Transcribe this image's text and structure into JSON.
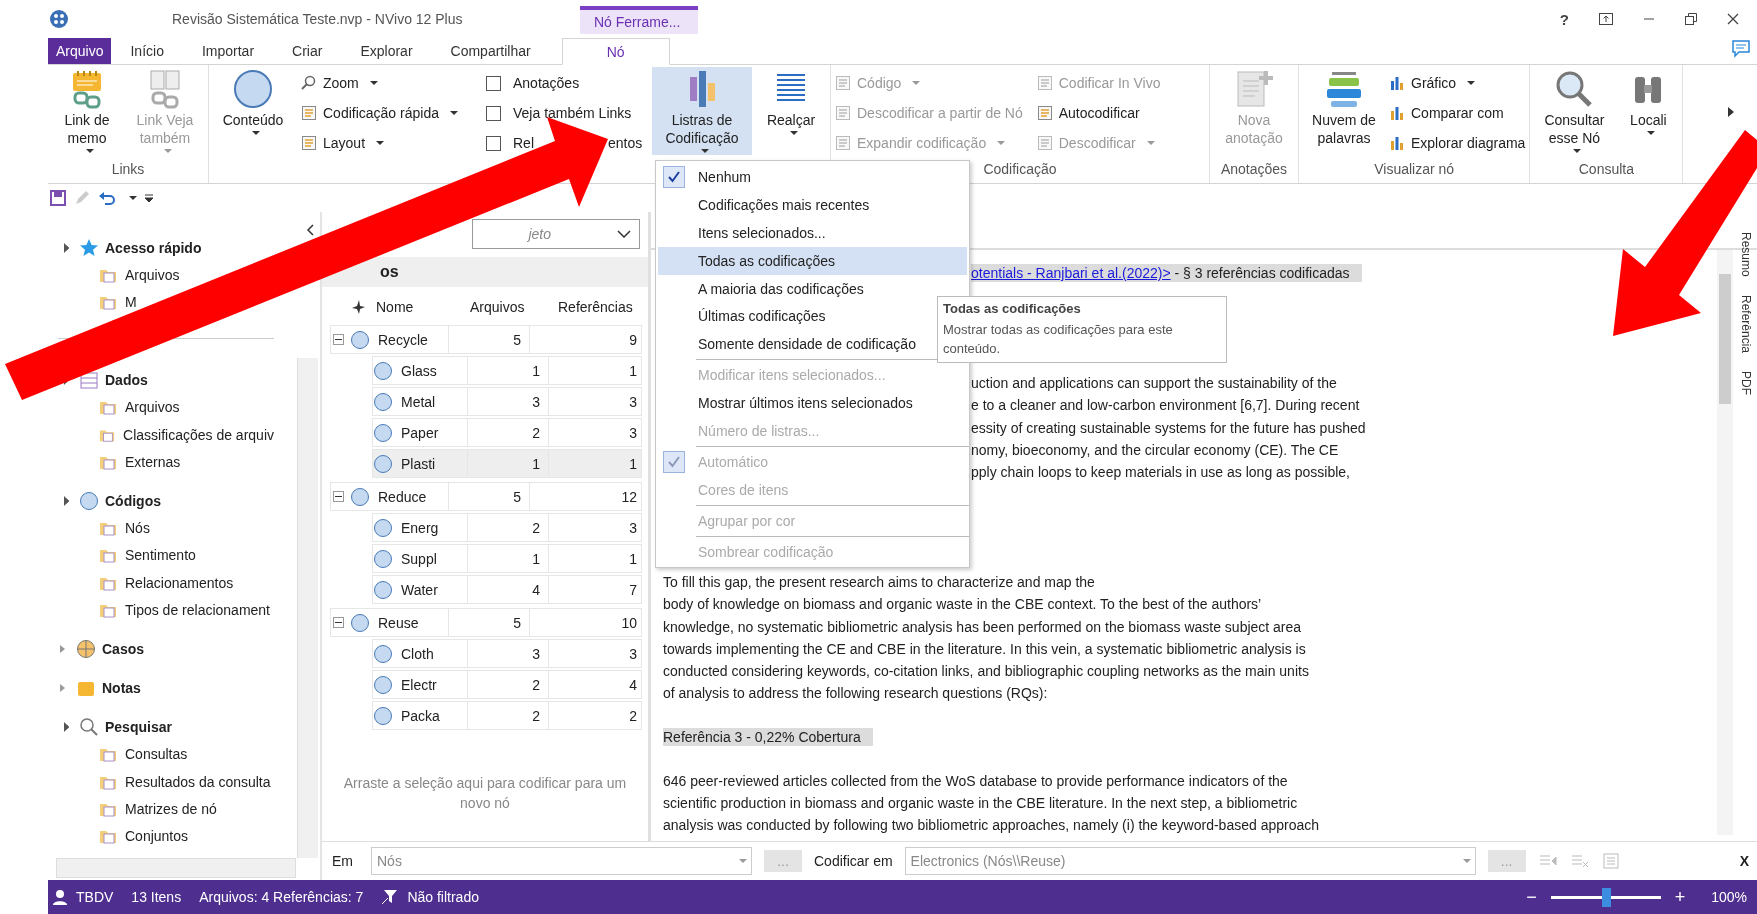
{
  "window": {
    "title": "Revisão Sistemática Teste.nvp - NVivo 12 Plus",
    "context_group": "Nó  Ferrame...",
    "help": "?"
  },
  "tabs": [
    {
      "label": "Arquivo",
      "kind": "file",
      "selected": false
    },
    {
      "label": "Início",
      "kind": "tab",
      "selected": false
    },
    {
      "label": "Importar",
      "kind": "tab",
      "selected": false
    },
    {
      "label": "Criar",
      "kind": "tab",
      "selected": false
    },
    {
      "label": "Explorar",
      "kind": "tab",
      "selected": false
    },
    {
      "label": "Compartilhar",
      "kind": "tab",
      "selected": false
    },
    {
      "label": "Nó",
      "kind": "context",
      "selected": true
    }
  ],
  "ribbon": [
    {
      "label": "Links",
      "items": [
        {
          "kind": "big",
          "label": "Link de memo",
          "dropdown": true,
          "disabled": false,
          "pressed": false
        },
        {
          "kind": "big",
          "label": "Link Veja também",
          "dropdown": true,
          "disabled": true,
          "pressed": false
        }
      ]
    },
    {
      "items": [
        {
          "kind": "big",
          "label": "Conteúdo",
          "dropdown": true,
          "disabled": false,
          "pressed": false
        }
      ]
    },
    {
      "items": [
        {
          "kind": "small",
          "label": "Zoom",
          "dropdown": true,
          "disabled": false
        },
        {
          "kind": "small",
          "label": "Codificação rápida",
          "dropdown": true,
          "disabled": false
        },
        {
          "kind": "small",
          "label": "Layout",
          "dropdown": true,
          "disabled": false
        }
      ]
    },
    {
      "items": [
        {
          "kind": "check",
          "label": "Anotações",
          "checked": false
        },
        {
          "kind": "check",
          "label": "Veja também Links",
          "checked": false
        },
        {
          "kind": "check",
          "label": "Rel",
          "label_end": "entos",
          "checked": false
        }
      ]
    },
    {
      "items": [
        {
          "kind": "big",
          "label": "Listras de Codificação",
          "dropdown": true,
          "disabled": false,
          "pressed": true
        },
        {
          "kind": "big",
          "label": "Realçar",
          "dropdown": true,
          "disabled": false,
          "pressed": false
        }
      ]
    },
    {
      "label": "Codificação",
      "items": [
        {
          "kind": "small",
          "label": "Código",
          "dropdown": true,
          "disabled": true
        },
        {
          "kind": "small",
          "label": "Descodificar a partir de Nó",
          "dropdown": false,
          "disabled": true
        },
        {
          "kind": "small",
          "label": "Expandir codificação",
          "dropdown": true,
          "disabled": true
        },
        {
          "kind": "small",
          "label": "Codificar In Vivo",
          "dropdown": false,
          "disabled": true
        },
        {
          "kind": "small",
          "label": "Autocodificar",
          "dropdown": false,
          "disabled": false
        },
        {
          "kind": "small",
          "label": "Descodificar",
          "dropdown": true,
          "disabled": true
        }
      ]
    },
    {
      "label": "Anotações",
      "items": [
        {
          "kind": "big",
          "label": "Nova anotação",
          "dropdown": false,
          "disabled": true,
          "pressed": false
        }
      ]
    },
    {
      "label": "Visualizar nó",
      "items": [
        {
          "kind": "big",
          "label": "Nuvem de palavras",
          "dropdown": false,
          "disabled": false,
          "pressed": false
        },
        {
          "kind": "small",
          "label": "Gráfico",
          "dropdown": true,
          "disabled": false
        },
        {
          "kind": "small",
          "label": "Comparar com",
          "dropdown": false,
          "disabled": false
        },
        {
          "kind": "small",
          "label": "Explorar diagrama",
          "dropdown": false,
          "disabled": false
        }
      ]
    },
    {
      "label": "Consulta",
      "items": [
        {
          "kind": "big",
          "label": "Consultar esse Nó",
          "dropdown": true,
          "disabled": false,
          "pressed": false
        },
        {
          "kind": "big",
          "label": "Locali",
          "dropdown": true,
          "disabled": false,
          "pressed": false
        }
      ]
    }
  ],
  "navigation": [
    {
      "label": "Acesso rápido",
      "expanded": true,
      "children": [
        {
          "label": "Arquivos"
        },
        {
          "label": "M"
        }
      ]
    },
    {
      "label": "Dados",
      "expanded": true,
      "children": [
        {
          "label": "Arquivos"
        },
        {
          "label": "Classificações de arquiv"
        },
        {
          "label": "Externas"
        }
      ]
    },
    {
      "label": "Códigos",
      "expanded": true,
      "children": [
        {
          "label": "Nós"
        },
        {
          "label": "Sentimento"
        },
        {
          "label": "Relacionamentos"
        },
        {
          "label": "Tipos de relacionament"
        }
      ]
    },
    {
      "label": "Casos",
      "expanded": false
    },
    {
      "label": "Notas",
      "expanded": false
    },
    {
      "label": "Pesquisar",
      "expanded": true,
      "children": [
        {
          "label": "Consultas"
        },
        {
          "label": "Resultados da consulta"
        },
        {
          "label": "Matrizes de nó"
        },
        {
          "label": "Conjuntos"
        }
      ]
    }
  ],
  "codes_panel": {
    "search": {
      "placeholder": "jeto"
    },
    "title": "os",
    "columns": [
      "Nome",
      "Arquivos",
      "Referências"
    ],
    "rows": [
      {
        "name": "Recycle",
        "files": "5",
        "references": "9",
        "expanded": true,
        "selected": false,
        "children": [
          {
            "name": "Glass",
            "files": "1",
            "references": "1",
            "selected": false
          },
          {
            "name": "Metal",
            "files": "3",
            "references": "3",
            "selected": false
          },
          {
            "name": "Paper",
            "files": "2",
            "references": "3",
            "selected": false
          },
          {
            "name": "Plasti",
            "files": "1",
            "references": "1",
            "selected": true
          }
        ]
      },
      {
        "name": "Reduce",
        "files": "5",
        "references": "12",
        "expanded": true,
        "selected": false,
        "children": [
          {
            "name": "Energ",
            "files": "2",
            "references": "3",
            "selected": false
          },
          {
            "name": "Suppl",
            "files": "1",
            "references": "1",
            "selected": false
          },
          {
            "name": "Water",
            "files": "4",
            "references": "7",
            "selected": false
          }
        ]
      },
      {
        "name": "Reuse",
        "files": "5",
        "references": "10",
        "expanded": true,
        "selected": false,
        "children": [
          {
            "name": "Cloth",
            "files": "3",
            "references": "3",
            "selected": false
          },
          {
            "name": "Electr",
            "files": "2",
            "references": "4",
            "selected": false
          },
          {
            "name": "Packa",
            "files": "2",
            "references": "2",
            "selected": false
          }
        ]
      }
    ],
    "hint": "Arraste a seleção aqui para codificar para um novo nó"
  },
  "document": {
    "header_link": "otentials - Ranjbari et al.(2022)>",
    "header_text": " - § 3 referências codificadas",
    "fragment_lines": [
      "uction and applications can support the sustainability of the",
      "e to a cleaner and low-carbon environment [6,7]. During recent",
      "essity of creating sustainable systems for the future has pushed",
      "nomy, bioeconomy, and the circular economy (CE). The CE",
      "pply chain loops to keep materials in use as long as possible,"
    ],
    "paragraph_2": [
      "To fill this gap, the present research aims to characterize and map the",
      "body of knowledge on biomass and organic waste in the CBE context. To the best of the authors’",
      "knowledge, no systematic bibliometric analysis has been performed on the biomass waste subject area",
      "towards implementing the CE and CBE in the literature. In this vein, a systematic bibliometric analysis is",
      "conducted considering keywords, co-citation links, and bibliographic coupling networks as the main units",
      "of analysis to address the following research questions (RQs):"
    ],
    "reference_heading": "Referência 3 - 0,22% Cobertura",
    "paragraph_3": [
      "646 peer-reviewed articles collected from the WoS database to provide performance indicators of the",
      "scientific production in biomass and organic waste in the CBE literature. In the next step, a bibliometric",
      "analysis was conducted by following two bibliometric approaches, namely (i) the keyword-based approach"
    ]
  },
  "side_tabs": [
    "Resumo",
    "Referência",
    "PDF"
  ],
  "code_bar": {
    "in_label": "Em",
    "in_value": "Nós",
    "browse": "...",
    "code_in_label": "Codificar em",
    "code_in_value": "Electronics (Nós\\\\Reuse)",
    "browse_2": "...",
    "close": "X"
  },
  "status_bar": {
    "user": "TBDV",
    "items": "13 Itens",
    "counts": "Arquivos: 4 Referências: 7",
    "filter": "Não filtrado",
    "zoom_minus": "−",
    "zoom_plus": "+",
    "zoom_slider": {
      "level": 0.5
    },
    "zoom_percent": "100%"
  },
  "menu": [
    {
      "kind": "item",
      "label": "Nenhum",
      "checked": true,
      "disabled": false,
      "selected": false
    },
    {
      "kind": "item",
      "label": "Codificações mais recentes",
      "checked": false,
      "disabled": false,
      "selected": false
    },
    {
      "kind": "item",
      "label": "Itens selecionados...",
      "checked": false,
      "disabled": false,
      "selected": false
    },
    {
      "kind": "item",
      "label": "Todas as codificações",
      "checked": false,
      "disabled": false,
      "selected": true
    },
    {
      "kind": "item",
      "label": "A maioria das codificações",
      "checked": false,
      "disabled": false,
      "selected": false
    },
    {
      "kind": "item",
      "label": "Últimas codificações",
      "checked": false,
      "disabled": false,
      "selected": false
    },
    {
      "kind": "item",
      "label": "Somente densidade de codificação",
      "checked": false,
      "disabled": false,
      "selected": false
    },
    {
      "kind": "separator"
    },
    {
      "kind": "item",
      "label": "Modificar itens selecionados...",
      "checked": false,
      "disabled": true,
      "selected": false
    },
    {
      "kind": "item",
      "label": "Mostrar últimos itens selecionados",
      "checked": false,
      "disabled": false,
      "selected": false
    },
    {
      "kind": "item",
      "label": "Número de listras...",
      "checked": false,
      "disabled": true,
      "selected": false
    },
    {
      "kind": "separator"
    },
    {
      "kind": "item",
      "label": "Automático",
      "checked": true,
      "disabled": true,
      "selected": false
    },
    {
      "kind": "item",
      "label": "Cores de itens",
      "checked": false,
      "disabled": true,
      "selected": false
    },
    {
      "kind": "separator"
    },
    {
      "kind": "item",
      "label": "Agrupar por cor",
      "checked": false,
      "disabled": true,
      "selected": false
    },
    {
      "kind": "separator"
    },
    {
      "kind": "item",
      "label": "Sombrear codificação",
      "checked": false,
      "disabled": true,
      "selected": false
    }
  ],
  "tooltip": {
    "title": "Todas as codificações",
    "text": "Mostrar todas as codificações para este conteúdo."
  }
}
